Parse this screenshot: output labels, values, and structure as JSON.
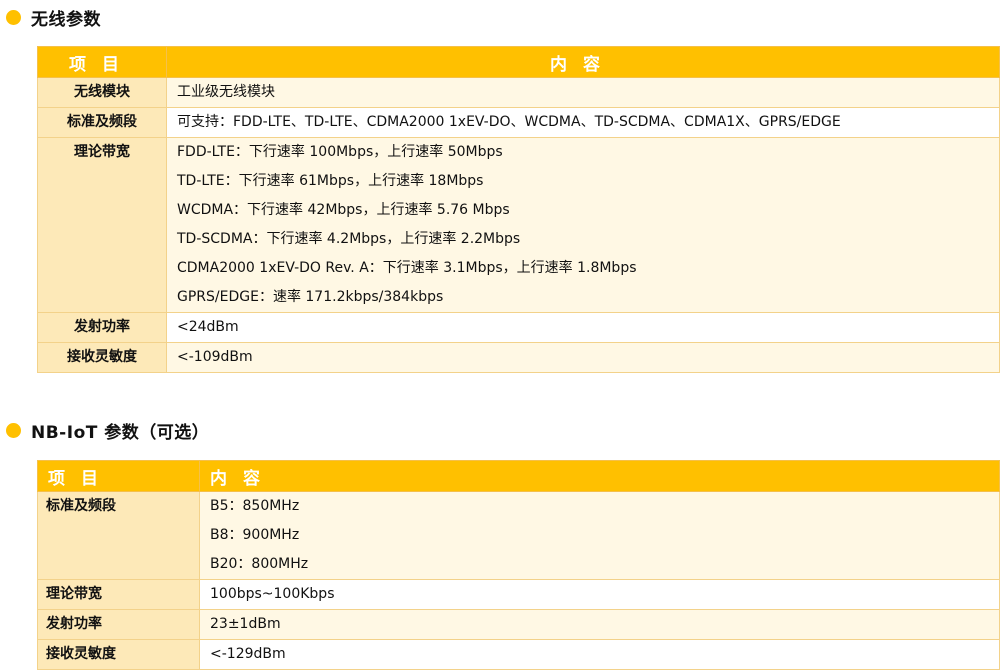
{
  "section1": {
    "title": "无线参数",
    "header": {
      "item": "项目",
      "content": "内容"
    },
    "rows": [
      {
        "label": "无线模块",
        "lines": [
          "工业级无线模块"
        ]
      },
      {
        "label": "标准及频段",
        "lines": [
          "可支持：FDD-LTE、TD-LTE、CDMA2000 1xEV-DO、WCDMA、TD-SCDMA、CDMA1X、GPRS/EDGE"
        ]
      },
      {
        "label": "理论带宽",
        "lines": [
          "FDD-LTE：下行速率 100Mbps，上行速率 50Mbps",
          "TD-LTE：下行速率 61Mbps，上行速率 18Mbps",
          "WCDMA：下行速率 42Mbps，上行速率 5.76 Mbps",
          "TD-SCDMA：下行速率 4.2Mbps，上行速率 2.2Mbps",
          "CDMA2000 1xEV-DO Rev. A：下行速率 3.1Mbps，上行速率 1.8Mbps",
          "GPRS/EDGE：速率 171.2kbps/384kbps"
        ]
      },
      {
        "label": "发射功率",
        "lines": [
          "<24dBm"
        ]
      },
      {
        "label": "接收灵敏度",
        "lines": [
          "<-109dBm"
        ]
      }
    ]
  },
  "section2": {
    "title": "NB-IoT 参数（可选）",
    "header": {
      "item": "项目",
      "content": "内容"
    },
    "rows": [
      {
        "label": "标准及频段",
        "lines": [
          "B5：850MHz",
          "B8：900MHz",
          "B20：800MHz"
        ]
      },
      {
        "label": "理论带宽",
        "lines": [
          "100bps~100Kbps"
        ]
      },
      {
        "label": "发射功率",
        "lines": [
          "23±1dBm"
        ]
      },
      {
        "label": "接收灵敏度",
        "lines": [
          "<-129dBm"
        ]
      }
    ]
  },
  "colors": {
    "accent": "#ffc000",
    "label_bg": "#fde9b8",
    "row_tint": "#fff8e4"
  }
}
